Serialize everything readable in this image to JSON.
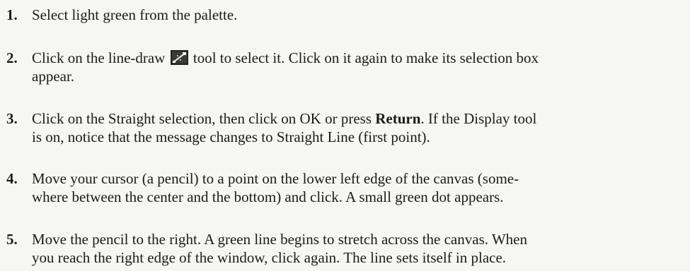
{
  "steps": [
    {
      "number": "1.",
      "text": "Select light green from the palette."
    },
    {
      "number": "2.",
      "line1_before_icon": "Click on the line-draw",
      "icon": "line-draw-tool-icon",
      "line1_after_icon": "tool to select it. Click on it again to make its selection box",
      "line2": "appear."
    },
    {
      "number": "3.",
      "line1_before_bold": "Click on the Straight selection, then click on OK or press",
      "bold": "Return",
      "line1_after_bold": ". If the Display tool",
      "line2": "is on, notice that the message changes to Straight Line (first point)."
    },
    {
      "number": "4.",
      "line1": "Move your cursor (a pencil) to a point on the lower left edge of the canvas (some-",
      "line2": "where between the center and the bottom) and click. A small green dot appears."
    },
    {
      "number": "5.",
      "line1": "Move the pencil to the right. A green line begins to stretch across the canvas. When",
      "line2": "you reach the right edge of the window, click again. The line sets itself in place."
    }
  ],
  "colors": {
    "text": "#1b1b1b",
    "background": "#f6f6f3",
    "icon_dark": "#222222"
  }
}
